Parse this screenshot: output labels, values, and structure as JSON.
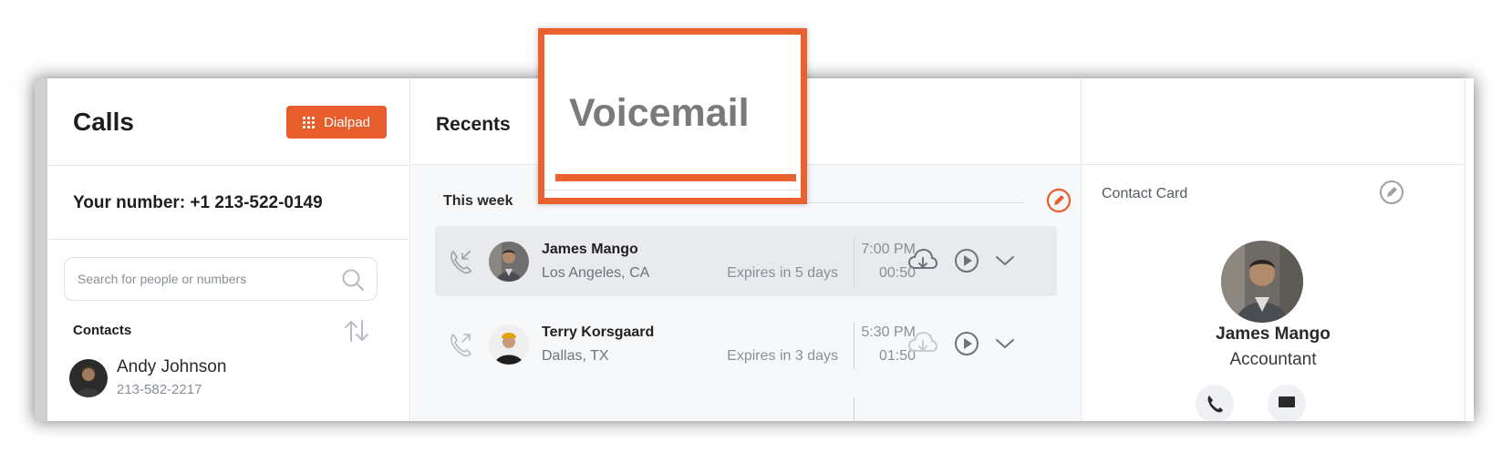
{
  "colors": {
    "accent": "#e85d2c",
    "muted": "#8a8f96",
    "active_row": "#e8eaee"
  },
  "left": {
    "title": "Calls",
    "dialpad_label": "Dialpad",
    "your_number": "Your number: +1 213-522-0149",
    "search_placeholder": "Search for people or numbers",
    "contacts_label": "Contacts",
    "contacts": [
      {
        "name": "Andy Johnson",
        "phone": "213-582-2217"
      }
    ]
  },
  "middle": {
    "title": "Recents",
    "active_tab": "Voicemail",
    "section_label": "This week",
    "voicemails": [
      {
        "name": "James Mango",
        "location": "Los Angeles, CA",
        "expires": "Expires in 5 days",
        "time": "7:00 PM",
        "duration": "00:50"
      },
      {
        "name": "Terry Korsgaard",
        "location": "Dallas, TX",
        "expires": "Expires in 3 days",
        "time": "5:30 PM",
        "duration": "01:50"
      }
    ]
  },
  "right": {
    "title": "Contact Card",
    "name": "James Mango",
    "role": "Accountant"
  }
}
